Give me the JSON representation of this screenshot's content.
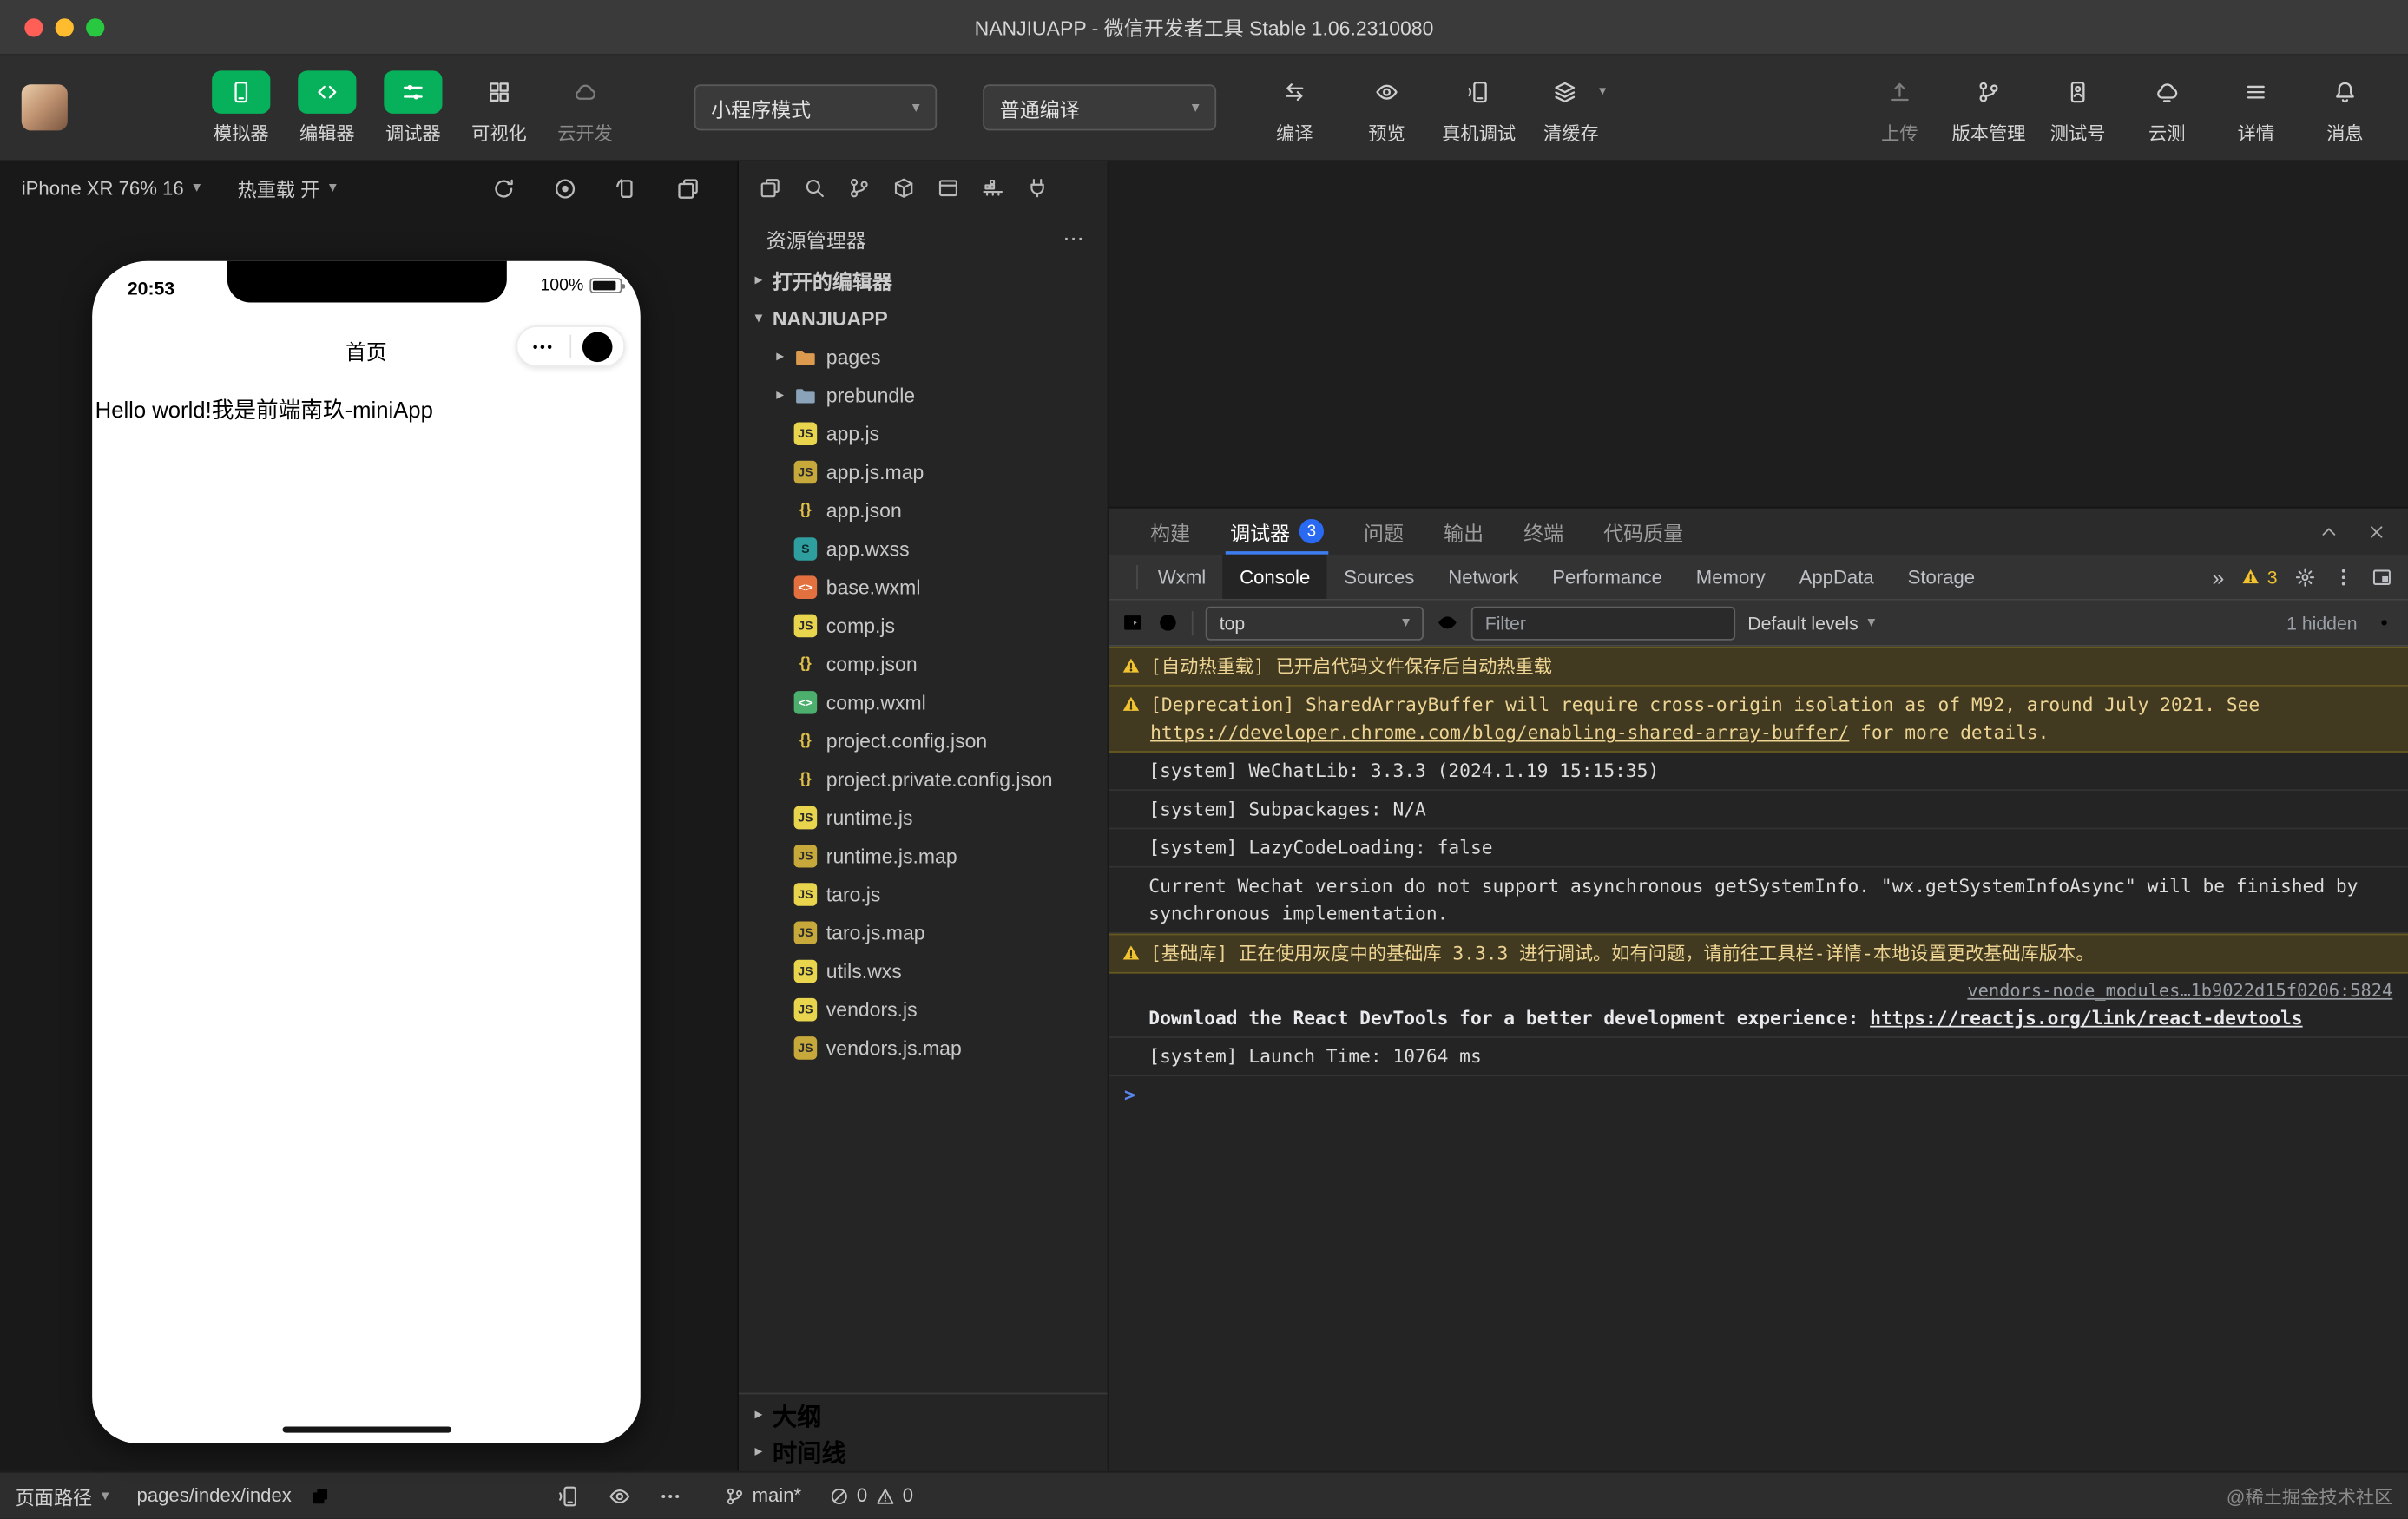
{
  "colors": {
    "accent_green": "#07b05a",
    "badge_blue": "#2a6af2",
    "warn_yellow": "#f1c232",
    "warn_bg": "#413a20"
  },
  "titlebar": {
    "title": "NANJIUAPP - 微信开发者工具 Stable 1.06.2310080"
  },
  "toolbar": {
    "left_buttons": [
      {
        "key": "simulator",
        "label": "模拟器",
        "icon": "simulator-icon",
        "variant": "green"
      },
      {
        "key": "editor",
        "label": "编辑器",
        "icon": "editor-icon",
        "variant": "green"
      },
      {
        "key": "debugger",
        "label": "调试器",
        "icon": "debugger-icon",
        "variant": "green"
      },
      {
        "key": "visualize",
        "label": "可视化",
        "icon": "visual-icon",
        "variant": "plain"
      },
      {
        "key": "cloud-dev",
        "label": "云开发",
        "icon": "cloud-icon",
        "variant": "disabled"
      }
    ],
    "mode_select": {
      "value": "小程序模式"
    },
    "compile_select": {
      "value": "普通编译"
    },
    "action_buttons": [
      {
        "key": "compile",
        "label": "编译",
        "icon": "compile-icon"
      },
      {
        "key": "preview",
        "label": "预览",
        "icon": "preview-icon"
      },
      {
        "key": "device-debug",
        "label": "真机调试",
        "icon": "device-debug-icon"
      },
      {
        "key": "clear-cache",
        "label": "清缓存",
        "icon": "clear-cache-icon",
        "caret": true
      }
    ],
    "right_buttons": [
      {
        "key": "upload",
        "label": "上传",
        "icon": "upload-icon",
        "variant": "disabled"
      },
      {
        "key": "version-manage",
        "label": "版本管理",
        "icon": "version-icon"
      },
      {
        "key": "test-account",
        "label": "测试号",
        "icon": "testid-icon"
      },
      {
        "key": "cloud-test",
        "label": "云测",
        "icon": "cloudtest-icon"
      },
      {
        "key": "details",
        "label": "详情",
        "icon": "details-icon"
      },
      {
        "key": "messages",
        "label": "消息",
        "icon": "message-icon"
      }
    ]
  },
  "simulator": {
    "device_label": "iPhone XR 76% 16",
    "hot_reload_label": "热重载 开",
    "toolbar_icons": [
      "refresh-icon",
      "record-icon",
      "rotate-icon",
      "screenshot-icon"
    ],
    "phone": {
      "status_time": "20:53",
      "battery_percent": "100%",
      "nav_title": "首页",
      "content_text": "Hello world!我是前端南玖-miniApp"
    }
  },
  "explorer": {
    "title": "资源管理器",
    "toolbar_icons": [
      "files-icon",
      "search-icon",
      "branch-icon",
      "package-icon",
      "window-icon",
      "container-icon",
      "plug-icon"
    ],
    "open_editors_label": "打开的编辑器",
    "project_label": "NANJIUAPP",
    "tree": [
      {
        "name": "pages",
        "icon": "folder-orange",
        "chevron": true
      },
      {
        "name": "prebundle",
        "icon": "folder-blue",
        "chevron": true
      },
      {
        "name": "app.js",
        "icon": "js"
      },
      {
        "name": "app.js.map",
        "icon": "jsmap"
      },
      {
        "name": "app.json",
        "icon": "json"
      },
      {
        "name": "app.wxss",
        "icon": "wxss"
      },
      {
        "name": "base.wxml",
        "icon": "wxml-orange"
      },
      {
        "name": "comp.js",
        "icon": "js"
      },
      {
        "name": "comp.json",
        "icon": "json"
      },
      {
        "name": "comp.wxml",
        "icon": "wxml-green"
      },
      {
        "name": "project.config.json",
        "icon": "json"
      },
      {
        "name": "project.private.config.json",
        "icon": "json"
      },
      {
        "name": "runtime.js",
        "icon": "js"
      },
      {
        "name": "runtime.js.map",
        "icon": "jsmap"
      },
      {
        "name": "taro.js",
        "icon": "js"
      },
      {
        "name": "taro.js.map",
        "icon": "jsmap"
      },
      {
        "name": "utils.wxs",
        "icon": "js"
      },
      {
        "name": "vendors.js",
        "icon": "js"
      },
      {
        "name": "vendors.js.map",
        "icon": "jsmap"
      }
    ],
    "footer_items": [
      "大纲",
      "时间线"
    ]
  },
  "debug_panel": {
    "tabs": [
      {
        "key": "build",
        "label": "构建"
      },
      {
        "key": "debugger",
        "label": "调试器",
        "badge": "3",
        "active": true
      },
      {
        "key": "problems",
        "label": "问题"
      },
      {
        "key": "output",
        "label": "输出"
      },
      {
        "key": "terminal",
        "label": "终端"
      },
      {
        "key": "code-quality",
        "label": "代码质量"
      }
    ],
    "devtools_tabs": [
      {
        "label": "Wxml"
      },
      {
        "label": "Console",
        "active": true
      },
      {
        "label": "Sources"
      },
      {
        "label": "Network"
      },
      {
        "label": "Performance"
      },
      {
        "label": "Memory"
      },
      {
        "label": "AppData"
      },
      {
        "label": "Storage"
      }
    ],
    "tabs_overflow_label": "»",
    "tab_warn_count": "3",
    "console_toolbar": {
      "context_value": "top",
      "filter_placeholder": "Filter",
      "levels_label": "Default levels",
      "hidden_label": "1 hidden"
    },
    "messages": [
      {
        "type": "warning",
        "text": "[自动热重载] 已开启代码文件保存后自动热重载"
      },
      {
        "type": "warning",
        "text": "[Deprecation] SharedArrayBuffer will require cross-origin isolation as of M92, around July 2021. See ",
        "link": "https://developer.chrome.com/blog/enabling-shared-array-buffer/",
        "suffix": " for more details."
      },
      {
        "type": "log",
        "text": "[system] WeChatLib: 3.3.3 (2024.1.19 15:15:35)"
      },
      {
        "type": "log",
        "text": "[system] Subpackages: N/A"
      },
      {
        "type": "log",
        "text": "[system] LazyCodeLoading: false"
      },
      {
        "type": "log",
        "text": "Current Wechat version do not support asynchronous getSystemInfo. \"wx.getSystemInfoAsync\" will be finished by synchronous implementation."
      },
      {
        "type": "warning",
        "text": "[基础库] 正在使用灰度中的基础库 3.3.3 进行调试。如有问题，请前往工具栏-详情-本地设置更改基础库版本。"
      },
      {
        "type": "info",
        "source": "vendors-node_modules…1b9022d15f0206:5824",
        "text": "Download the React DevTools for a better development experience: ",
        "link": "https://reactjs.org/link/react-devtools"
      },
      {
        "type": "log",
        "text": "[system] Launch Time: 10764 ms"
      },
      {
        "type": "prompt"
      }
    ]
  },
  "statusbar": {
    "page_path_label": "页面路径",
    "page_path_value": "pages/index/index",
    "icons": [
      "device-debug-icon",
      "preview-icon",
      "ellipsis-icon"
    ],
    "branch_label": "main*",
    "error_count": "0",
    "warning_count": "0",
    "watermark": "@稀土掘金技术社区"
  }
}
